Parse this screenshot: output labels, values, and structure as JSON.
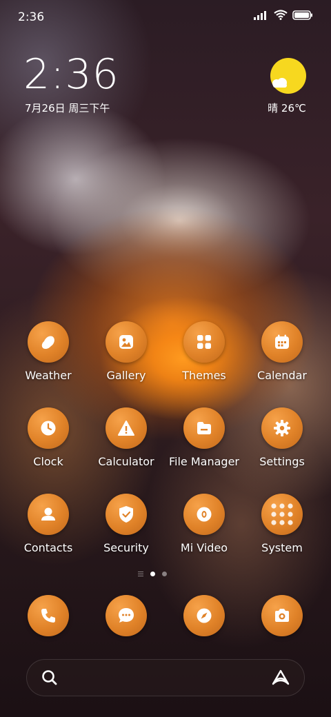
{
  "status_bar": {
    "time": "2:36",
    "icons": [
      "signal-icon",
      "wifi-icon",
      "battery-icon"
    ]
  },
  "clock_widget": {
    "time": "2:36",
    "date": "7月26日 周三下午"
  },
  "weather_widget": {
    "condition_icon": "partly-sunny-icon",
    "text": "晴 26℃"
  },
  "apps": [
    {
      "label": "Weather",
      "icon": "weather-drop-icon"
    },
    {
      "label": "Gallery",
      "icon": "gallery-icon"
    },
    {
      "label": "Themes",
      "icon": "themes-grid-icon"
    },
    {
      "label": "Calendar",
      "icon": "calendar-icon"
    },
    {
      "label": "Clock",
      "icon": "clock-icon"
    },
    {
      "label": "Calculator",
      "icon": "calculator-icon"
    },
    {
      "label": "File Manager",
      "icon": "folder-icon"
    },
    {
      "label": "Settings",
      "icon": "gear-icon"
    },
    {
      "label": "Contacts",
      "icon": "contacts-icon"
    },
    {
      "label": "Security",
      "icon": "shield-icon"
    },
    {
      "label": "Mi Video",
      "icon": "video-icon"
    },
    {
      "label": "System",
      "icon": "folder-grid-icon"
    }
  ],
  "page_indicator": {
    "pages": 3,
    "active_index": 1
  },
  "dock": [
    "phone-icon",
    "messages-icon",
    "browser-compass-icon",
    "camera-icon"
  ],
  "search_bar": {
    "left_icon": "search-icon",
    "right_icon": "app-vault-icon"
  },
  "colors": {
    "icon_orange": "#e08228",
    "sun_yellow": "#f7d81f"
  }
}
